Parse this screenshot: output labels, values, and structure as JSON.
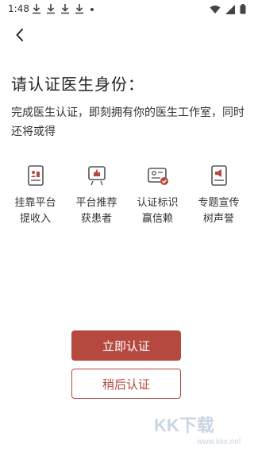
{
  "status_bar": {
    "time": "1:48"
  },
  "header": {
    "back_icon": "chevron-left-icon"
  },
  "title": "请认证医生身份：",
  "description": "完成医生认证，即刻拥有你的医生工作室，同时还将或得",
  "features": [
    {
      "icon": "document-id-icon",
      "line1": "挂靠平台",
      "line2": "提收入"
    },
    {
      "icon": "thumbs-up-icon",
      "line1": "平台推荐",
      "line2": "获患者"
    },
    {
      "icon": "verified-card-icon",
      "line1": "认证标识",
      "line2": "赢信赖"
    },
    {
      "icon": "megaphone-doc-icon",
      "line1": "专题宣传",
      "line2": "树声誉"
    }
  ],
  "buttons": {
    "primary": "立即认证",
    "secondary": "稍后认证"
  },
  "watermark": {
    "text": "KK下载",
    "url": "www.kkx.net"
  },
  "colors": {
    "accent": "#b5493f",
    "icon_gray": "#666666"
  }
}
